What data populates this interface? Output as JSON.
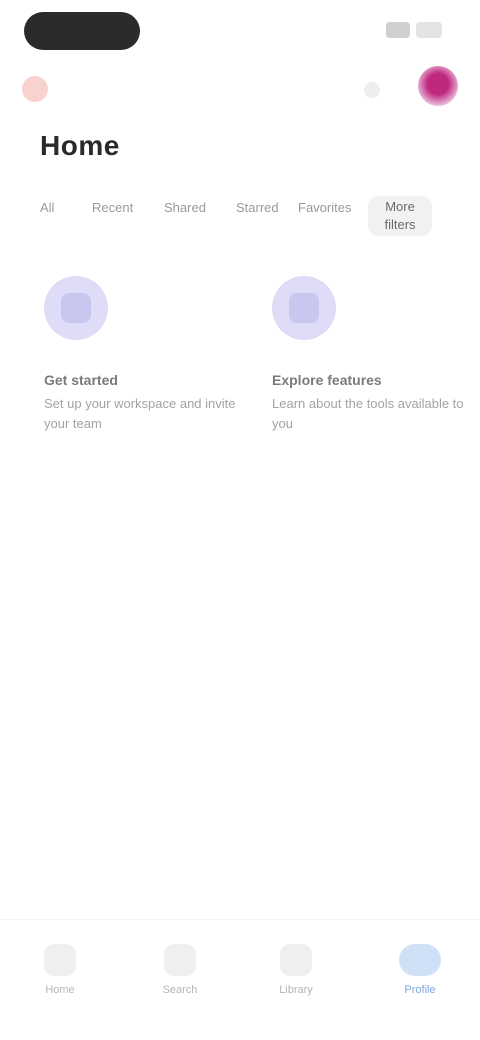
{
  "header": {
    "title": "Home"
  },
  "filters": {
    "chips": [
      "All",
      "Recent",
      "Shared",
      "Starred",
      "Favorites"
    ],
    "selected_label": "More filters"
  },
  "cards": [
    {
      "title": "Get started",
      "description": "Set up your workspace and invite your team"
    },
    {
      "title": "Explore features",
      "description": "Learn about the tools available to you"
    }
  ],
  "bottom_nav": [
    {
      "label": "Home",
      "icon": "home-icon"
    },
    {
      "label": "Search",
      "icon": "search-icon"
    },
    {
      "label": "Library",
      "icon": "library-icon"
    },
    {
      "label": "Profile",
      "icon": "profile-icon",
      "active": true
    }
  ],
  "colors": {
    "accent": "#7ea7db",
    "avatar": "#c0287f",
    "card_icon_bg": "#dedcf6"
  }
}
